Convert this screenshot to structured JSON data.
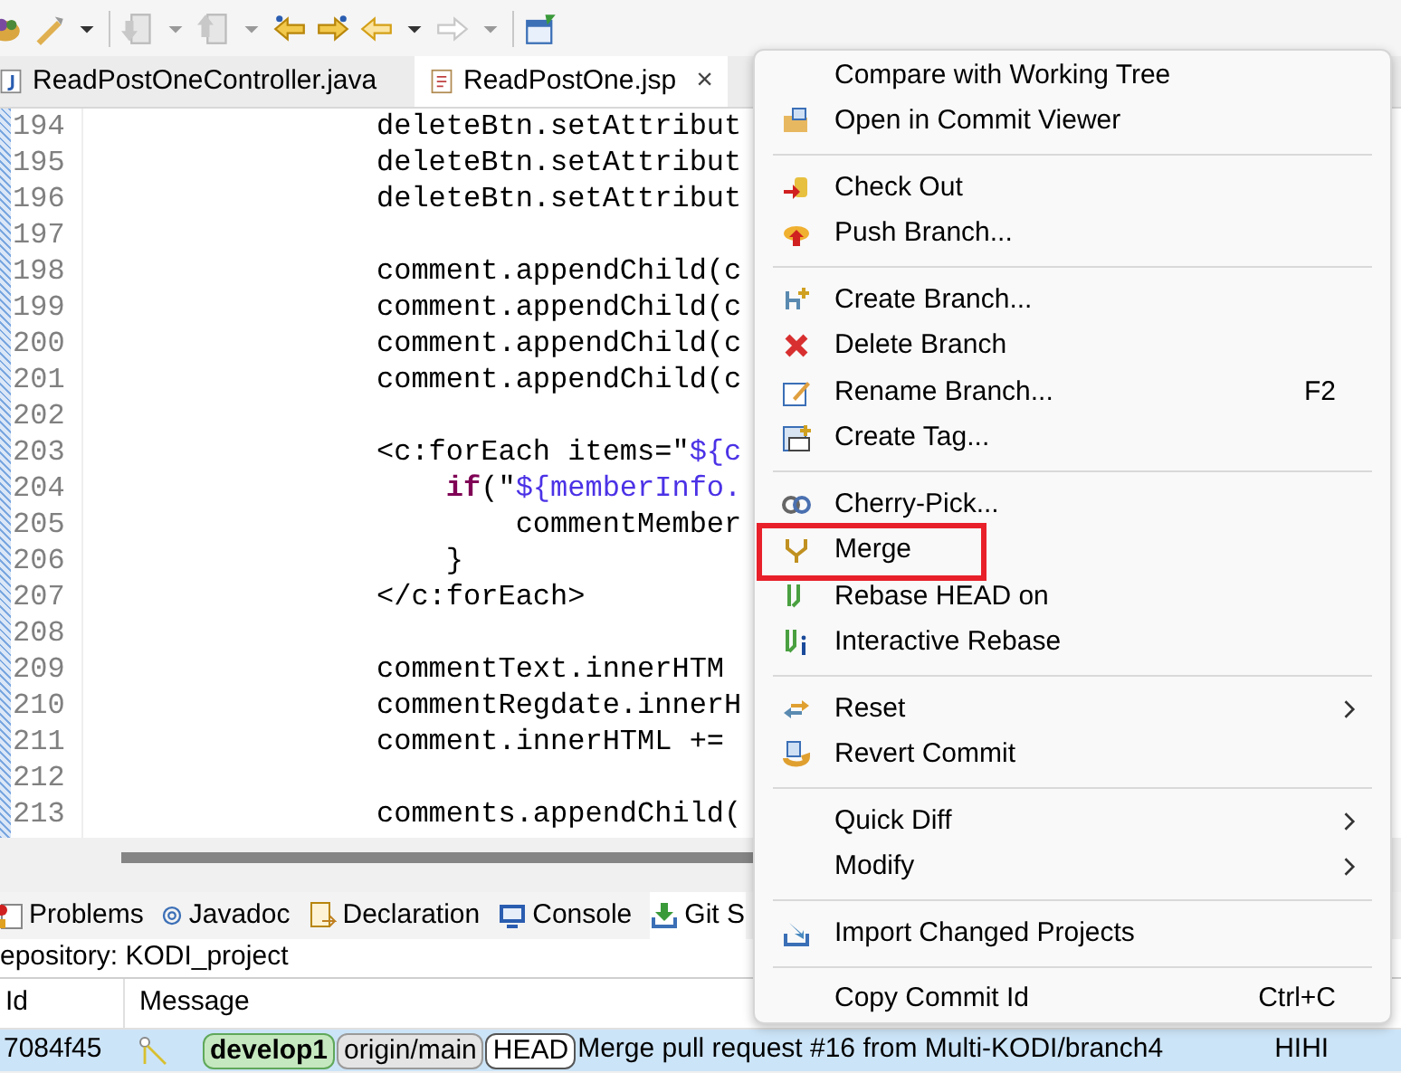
{
  "editor_tabs": [
    {
      "label": "ReadPostOneController.java",
      "selected": false
    },
    {
      "label": "ReadPostOne.jsp",
      "selected": true,
      "close": "×"
    }
  ],
  "code_lines": [
    {
      "number": "194",
      "segments": [
        {
          "text": "deleteBtn.setAttribut",
          "kind": "plain"
        }
      ]
    },
    {
      "number": "195",
      "segments": [
        {
          "text": "deleteBtn.setAttribut",
          "kind": "plain"
        }
      ]
    },
    {
      "number": "196",
      "segments": [
        {
          "text": "deleteBtn.setAttribut",
          "kind": "plain"
        }
      ]
    },
    {
      "number": "197"
    },
    {
      "number": "198",
      "segments": [
        {
          "text": "comment.appendChild(c",
          "kind": "plain"
        }
      ]
    },
    {
      "number": "199",
      "segments": [
        {
          "text": "comment.appendChild(c",
          "kind": "plain"
        }
      ]
    },
    {
      "number": "200",
      "segments": [
        {
          "text": "comment.appendChild(c",
          "kind": "plain"
        }
      ]
    },
    {
      "number": "201",
      "segments": [
        {
          "text": "comment.appendChild(c",
          "kind": "plain"
        }
      ]
    },
    {
      "number": "202"
    },
    {
      "number": "203",
      "segments": [
        {
          "text": "<c:forEach items=\"",
          "kind": "plain"
        },
        {
          "text": "${c",
          "kind": "el"
        }
      ]
    },
    {
      "number": "204",
      "segments": [
        {
          "text": "    if",
          "kind": "keyword"
        },
        {
          "text": "(\"",
          "kind": "plain"
        },
        {
          "text": "${memberInfo.",
          "kind": "el"
        }
      ]
    },
    {
      "number": "205",
      "segments": [
        {
          "text": "        commentMember",
          "kind": "plain"
        }
      ]
    },
    {
      "number": "206",
      "segments": [
        {
          "text": "    }",
          "kind": "plain"
        }
      ]
    },
    {
      "number": "207",
      "segments": [
        {
          "text": "</c:forEach>",
          "kind": "plain"
        }
      ]
    },
    {
      "number": "208"
    },
    {
      "number": "209",
      "segments": [
        {
          "text": "commentText.innerHTM",
          "kind": "plain"
        }
      ]
    },
    {
      "number": "210",
      "segments": [
        {
          "text": "commentRegdate.innerH",
          "kind": "plain"
        }
      ]
    },
    {
      "number": "211",
      "segments": [
        {
          "text": "comment.innerHTML +=",
          "kind": "plain"
        }
      ]
    },
    {
      "number": "212"
    },
    {
      "number": "213",
      "segments": [
        {
          "text": "comments.appendChild(",
          "kind": "plain"
        }
      ]
    }
  ],
  "view_tabs": [
    {
      "label": "Problems",
      "selected": false
    },
    {
      "label": "Javadoc",
      "selected": false
    },
    {
      "label": "Declaration",
      "selected": false
    },
    {
      "label": "Console",
      "selected": false
    },
    {
      "label": "Git S",
      "selected": true
    }
  ],
  "repository_label": "epository: KODI_project",
  "history": {
    "columns": [
      "Id",
      "Message"
    ],
    "rows": [
      {
        "id": "7084f45",
        "refs": [
          {
            "label": "develop1",
            "kind": "local"
          },
          {
            "label": "origin/main",
            "kind": "remote"
          },
          {
            "label": "HEAD",
            "kind": "head"
          }
        ],
        "message": "Merge pull request #16 from Multi-KODI/branch4",
        "author": "HIHI",
        "selected": true
      }
    ]
  },
  "context_menu": [
    {
      "kind": "item",
      "label": "Compare with Working Tree"
    },
    {
      "kind": "item",
      "label": "Open in Commit Viewer"
    },
    {
      "kind": "separator"
    },
    {
      "kind": "item",
      "label": "Check Out"
    },
    {
      "kind": "item",
      "label": "Push Branch..."
    },
    {
      "kind": "separator"
    },
    {
      "kind": "item",
      "label": "Create Branch..."
    },
    {
      "kind": "item",
      "label": "Delete Branch"
    },
    {
      "kind": "item",
      "label": "Rename Branch...",
      "shortcut": "F2"
    },
    {
      "kind": "item",
      "label": "Create Tag..."
    },
    {
      "kind": "separator"
    },
    {
      "kind": "item",
      "label": "Cherry-Pick..."
    },
    {
      "kind": "item",
      "label": "Merge",
      "highlighted": true
    },
    {
      "kind": "item",
      "label": "Rebase HEAD on"
    },
    {
      "kind": "item",
      "label": "Interactive Rebase"
    },
    {
      "kind": "separator"
    },
    {
      "kind": "item",
      "label": "Reset",
      "submenu": true
    },
    {
      "kind": "item",
      "label": "Revert Commit"
    },
    {
      "kind": "separator"
    },
    {
      "kind": "item",
      "label": "Quick Diff",
      "submenu": true
    },
    {
      "kind": "item",
      "label": "Modify",
      "submenu": true
    },
    {
      "kind": "separator"
    },
    {
      "kind": "item",
      "label": "Import Changed Projects"
    },
    {
      "kind": "separator"
    },
    {
      "kind": "item",
      "label": "Copy Commit Id",
      "shortcut": "Ctrl+C"
    }
  ]
}
